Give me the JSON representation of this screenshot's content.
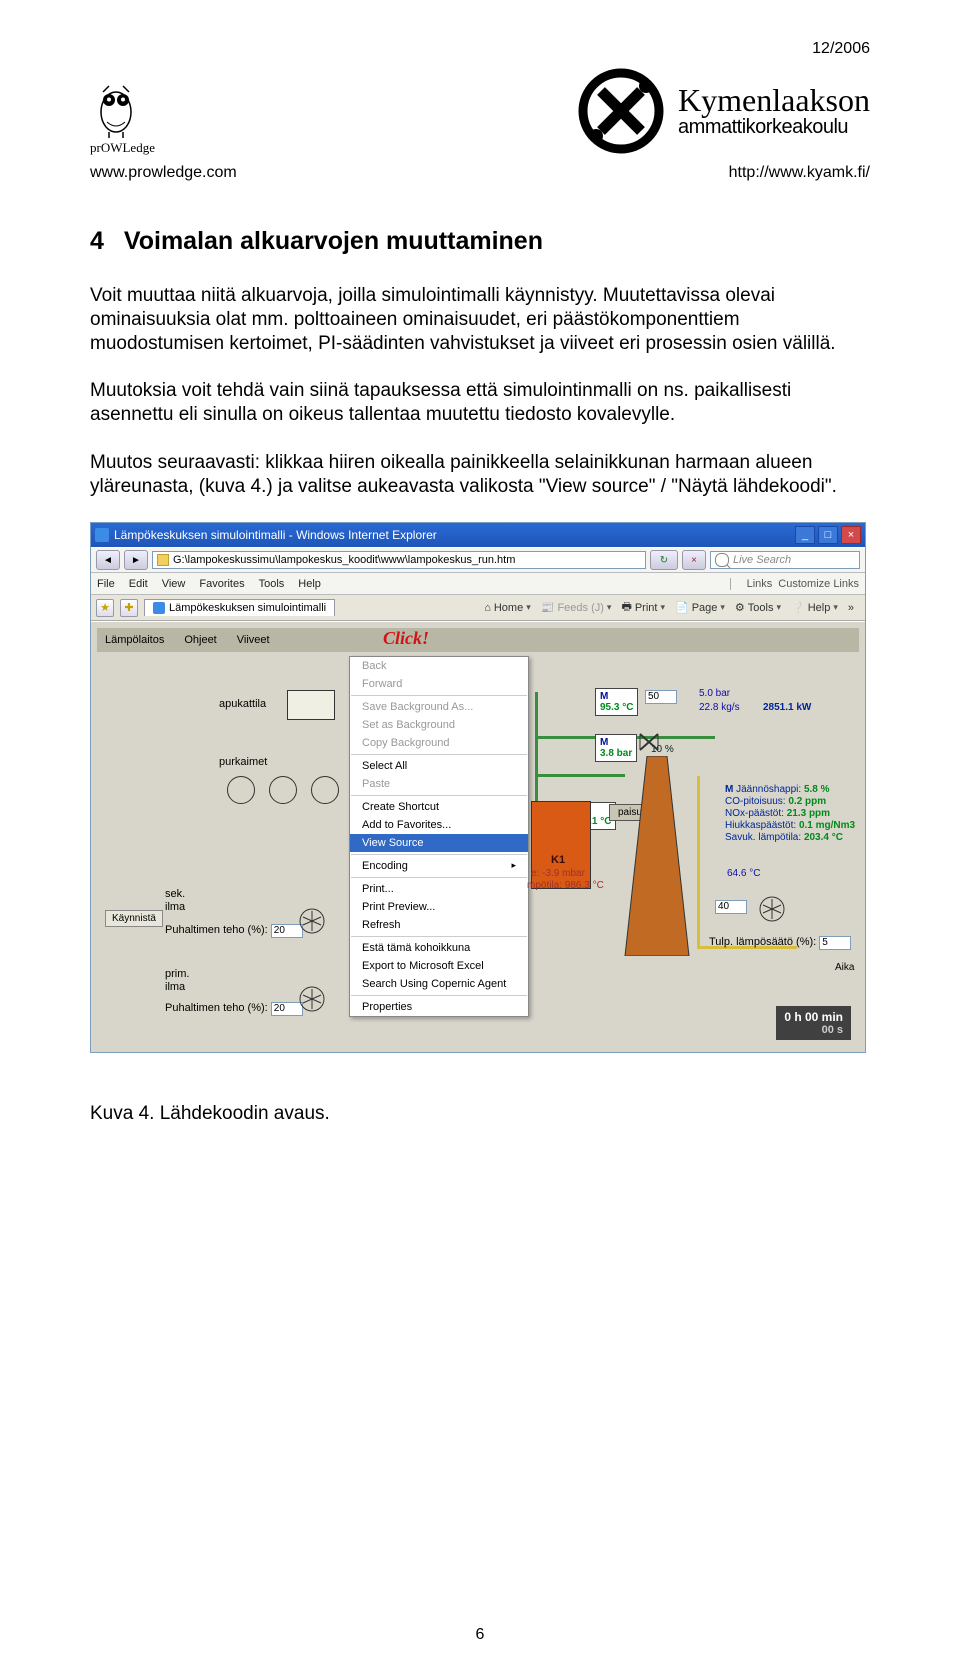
{
  "issue": "12/2006",
  "header": {
    "prowledge_brand": "prOWLedge",
    "url_left": "www.prowledge.com",
    "kyamk_name": "Kymenlaakson",
    "kyamk_sub": "ammattikorkeakoulu",
    "url_right": "http://www.kyamk.fi/"
  },
  "section": {
    "number": "4",
    "title": "Voimalan alkuarvojen muuttaminen",
    "p1": "Voit muuttaa niitä alkuarvoja, joilla simulointimalli käynnistyy. Muutettavissa olevai ominaisuuksia olat mm. polttoaineen ominaisuudet, eri päästökomponenttiem muodostumisen kertoimet, PI-säädinten vahvistukset ja viiveet eri prosessin osien välillä.",
    "p2": "Muutoksia voit tehdä vain siinä tapauksessa että simulointinmalli on ns. paikallisesti asennettu eli sinulla on oikeus tallentaa muutettu tiedosto kovalevylle.",
    "p3": "Muutos seuraavasti: klikkaa hiiren oikealla painikkeella selainikkunan harmaan alueen yläreunasta, (kuva 4.) ja valitse aukeavasta valikosta \"View source\" / \"Näytä lähdekoodi\"."
  },
  "screenshot": {
    "window_title": "Lämpökeskuksen simulointimalli - Windows Internet Explorer",
    "address_path": "G:\\lampokeskussimu\\lampokeskus_koodit\\www\\lampokeskus_run.htm",
    "search_placeholder": "Live Search",
    "menu": {
      "file": "File",
      "edit": "Edit",
      "view": "View",
      "favorites": "Favorites",
      "tools": "Tools",
      "help": "Help",
      "links": "Links",
      "custom": "Customize Links"
    },
    "tab_title": "Lämpökeskuksen simulointimalli",
    "ietools": {
      "home": "Home",
      "feeds": "Feeds (J)",
      "print": "Print",
      "page": "Page",
      "tools": "Tools",
      "help": "Help",
      "more": "»"
    },
    "topbar": {
      "lampo": "Lämpölaitos",
      "ohjeet": "Ohjeet",
      "viiveet": "Viiveet",
      "click": "Click!"
    },
    "context_menu": {
      "back": "Back",
      "forward": "Forward",
      "save_bg": "Save Background As...",
      "set_bg": "Set as Background",
      "copy_bg": "Copy Background",
      "select_all": "Select All",
      "paste": "Paste",
      "create_shortcut": "Create Shortcut",
      "add_fav": "Add to Favorites...",
      "view_source": "View Source",
      "encoding": "Encoding",
      "print": "Print...",
      "print_preview": "Print Preview...",
      "refresh": "Refresh",
      "esta": "Estä tämä kohoikkuna",
      "export_excel": "Export to Microsoft Excel",
      "search_copernic": "Search Using Copernic Agent",
      "properties": "Properties"
    },
    "diagram": {
      "apukattila": "apukattila",
      "purkaimet": "purkaimet",
      "sek": "sek.",
      "ilma": "ilma",
      "prim": "prim.",
      "kaynnista": "Käynnistä",
      "puh_teho": "Puhaltimen teho (%):",
      "val20": "20",
      "m1_t": "M",
      "m1_v": "95.3 °C",
      "m2_t": "M",
      "m2_v": "3.8 bar",
      "m3_t": "M",
      "m3_v": "66.1 °C",
      "input50": "50",
      "pct10": "10 %",
      "net1": "5.0 bar",
      "net2": "22.8 kg/s",
      "net3": "2851.1 kW",
      "net4": "64.6 °C",
      "paisunta": "paisunta",
      "k1": "K1",
      "e1": "e: -3.9 mbar",
      "e2": "mpötila: 986.3 °C",
      "em_m": "M",
      "em_j": "Jäännöshappi:",
      "em_jv": "5.8 %",
      "em_co": "CO-pitoisuus:",
      "em_cov": "0.2 ppm",
      "em_nox": "NOx-päästöt:",
      "em_noxv": "21.3 ppm",
      "em_hiuk": "Hiukkaspäästöt:",
      "em_hiukv": "0.1 mg/Nm3",
      "em_savu": "Savuk. lämpötila:",
      "em_savuv": "203.4 °C",
      "input40": "40",
      "tulp": "Tulp. lämpösäätö (%):",
      "input5": "5",
      "aika": "Aika",
      "timer_main": "0 h 00 min",
      "timer_sub": "00 s"
    }
  },
  "caption": "Kuva 4. Lähdekoodin avaus.",
  "page_number": "6"
}
